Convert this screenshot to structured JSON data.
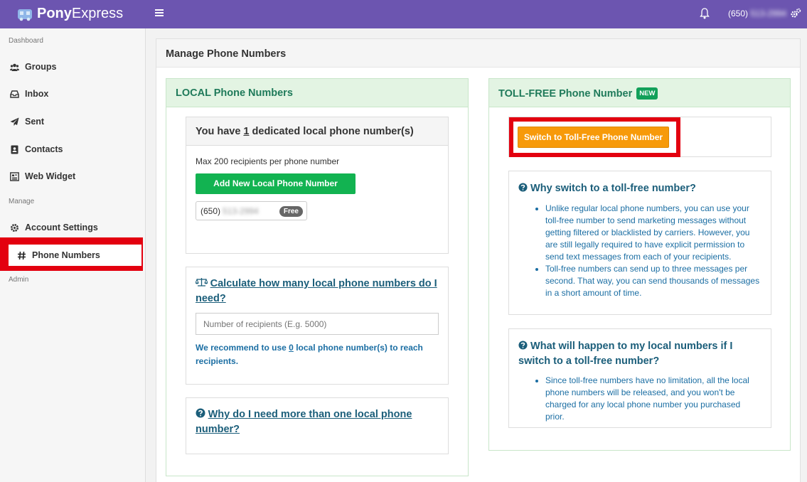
{
  "header": {
    "brand_bold": "Pony",
    "brand_light": "Express",
    "phone_prefix": "(650)",
    "phone_hidden": "513-2994"
  },
  "sidebar": {
    "section_dashboard": "Dashboard",
    "section_manage": "Manage",
    "section_admin": "Admin",
    "items": [
      {
        "label": "Groups",
        "icon": "users-icon"
      },
      {
        "label": "Inbox",
        "icon": "inbox-icon"
      },
      {
        "label": "Sent",
        "icon": "paper-plane-icon"
      },
      {
        "label": "Contacts",
        "icon": "address-book-icon"
      },
      {
        "label": "Web Widget",
        "icon": "widget-icon"
      },
      {
        "label": "Account Settings",
        "icon": "gear-icon"
      },
      {
        "label": "Phone Numbers",
        "icon": "hash-icon"
      }
    ]
  },
  "main": {
    "title": "Manage Phone Numbers",
    "local": {
      "title": "LOCAL Phone Numbers",
      "dedicated_prefix": "You have",
      "dedicated_count": "1",
      "dedicated_suffix": "dedicated local phone number(s)",
      "max_text": "Max 200 recipients per phone number",
      "add_button": "Add New Local Phone Number",
      "number_prefix": "(650)",
      "number_hidden": "513-2994",
      "number_badge": "Free",
      "calc_title": "Calculate how many local phone numbers do I need?",
      "recipients_placeholder": "Number of recipients (E.g. 5000)",
      "recommend_prefix": "We recommend to use",
      "recommend_count": "0",
      "recommend_suffix": "local phone number(s) to reach recipients.",
      "why_more_title": "Why do I need more than one local phone number?"
    },
    "tollfree": {
      "title": "TOLL-FREE Phone Number",
      "badge": "NEW",
      "switch_button": "Switch to Toll-Free Phone Number",
      "why_title": "Why switch to a toll-free number?",
      "why_points": [
        "Unlike regular local phone numbers, you can use your toll-free number to send marketing messages without getting filtered or blacklisted by carriers. However, you are still legally required to have explicit permission to send text messages from each of your recipients.",
        "Toll-free numbers can send up to three messages per second. That way, you can send thousands of messages in a short amount of time."
      ],
      "what_title": "What will happen to my local numbers if I switch to a toll-free number?",
      "what_points": [
        "Since toll-free numbers have no limitation, all the local phone numbers will be released, and you won't be charged for any local phone number you purchased prior."
      ]
    }
  },
  "colors": {
    "topbar": "#6c55b0",
    "highlight_red": "#e3000f",
    "green_button": "#12b351",
    "orange_button": "#f79a0a",
    "link_blue": "#1b5e7a"
  }
}
